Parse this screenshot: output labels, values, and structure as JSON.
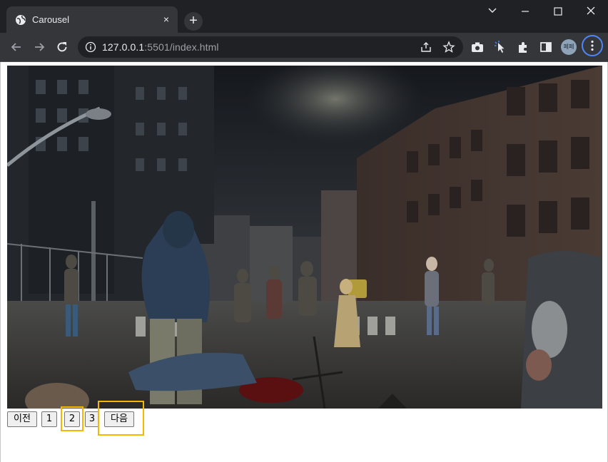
{
  "browser": {
    "tab_title": "Carousel",
    "tab_close": "×",
    "new_tab": "+",
    "url_host": "127.0.0.1",
    "url_rest": ":5501/index.html",
    "profile_label": "페페"
  },
  "carousel": {
    "image_alt": "zombie-city-street",
    "prev_label": "이전",
    "next_label": "다음",
    "pages": [
      "1",
      "2",
      "3"
    ],
    "active_page": "2"
  },
  "colors": {
    "titlebar": "#202124",
    "toolbar": "#35363a",
    "highlight": "#f5b800",
    "focus_ring": "#4f86f7"
  }
}
